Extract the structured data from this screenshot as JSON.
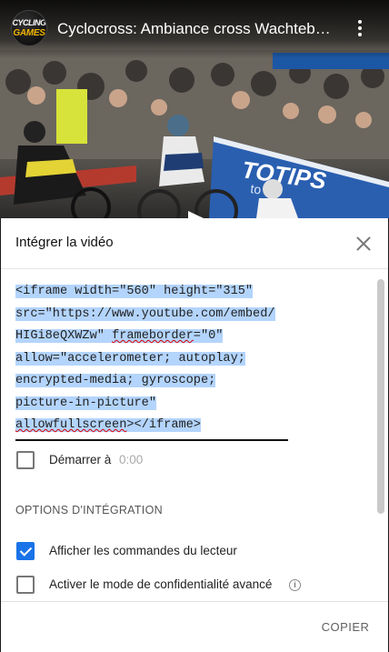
{
  "video": {
    "title": "Cyclocross: Ambiance cross Wachteb…",
    "channel_logo": {
      "line1": "CYCLING",
      "line2": "GAMES"
    },
    "more_icon": "vertical-ellipsis-icon",
    "banner_text": "TOTIPS",
    "banner_subtext": "to do"
  },
  "dialog": {
    "title": "Intégrer la vidéo",
    "close_icon": "close-icon",
    "embed_code": {
      "line1": "<iframe width=\"560\" height=\"315\"",
      "line2": "src=\"https://www.youtube.com/embed/",
      "line3_a": "HIGi8eQXWZw\" ",
      "line3_b": "frameborder",
      "line3_c": "=\"0\"",
      "line4": "allow=\"accelerometer; autoplay;",
      "line5": "encrypted-media; gyroscope;",
      "line6": "picture-in-picture\"",
      "line7_a": "allowfullscreen",
      "line7_b": "></iframe>"
    },
    "start_at": {
      "label": "Démarrer à",
      "value": "0:00",
      "checked": false
    },
    "options_title": "OPTIONS D'INTÉGRATION",
    "options": [
      {
        "label": "Afficher les commandes du lecteur",
        "checked": true
      },
      {
        "label": "Activer le mode de confidentialité avancé",
        "checked": false,
        "icon": "info-icon"
      }
    ],
    "copy_label": "COPIER"
  },
  "colors": {
    "selection": "#b3d4fc",
    "checkbox_checked": "#1a73e8",
    "text_primary": "#111111",
    "text_secondary": "#606060"
  }
}
